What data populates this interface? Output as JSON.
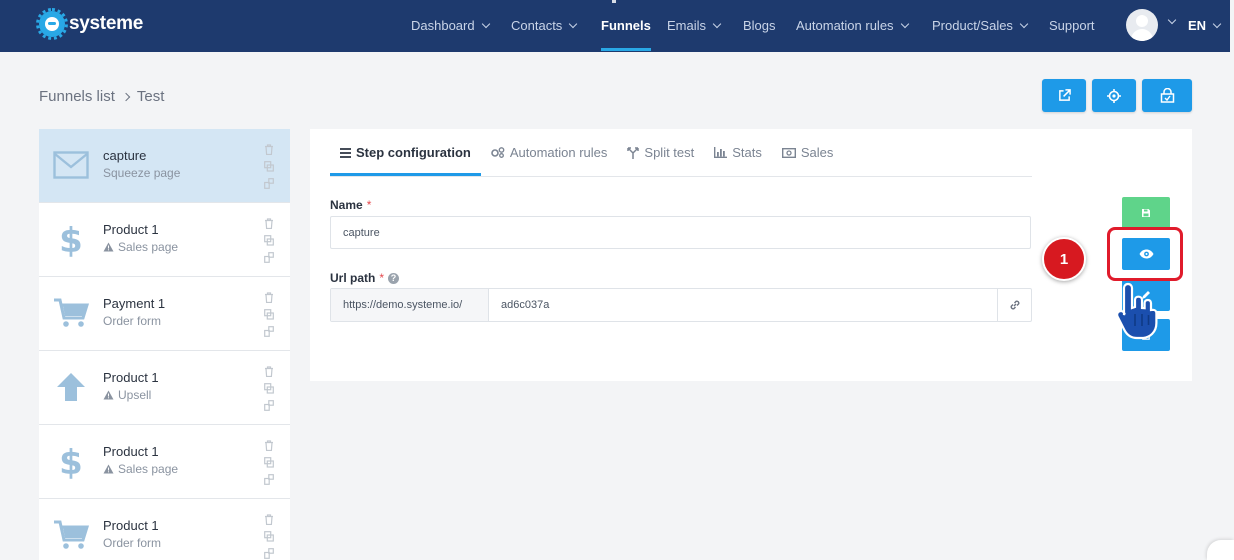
{
  "app": {
    "logo_text": "systeme"
  },
  "nav": {
    "items": [
      {
        "label": "Dashboard",
        "dropdown": true
      },
      {
        "label": "Contacts",
        "dropdown": true
      },
      {
        "label": "Funnels",
        "dropdown": false,
        "active": true
      },
      {
        "label": "Emails",
        "dropdown": true
      },
      {
        "label": "Blogs",
        "dropdown": false
      },
      {
        "label": "Automation rules",
        "dropdown": true
      },
      {
        "label": "Product/Sales",
        "dropdown": true
      },
      {
        "label": "Support",
        "dropdown": false
      }
    ],
    "language": "EN"
  },
  "breadcrumb": {
    "parent": "Funnels list",
    "current": "Test"
  },
  "top_actions": {
    "icons": [
      "external-link-icon",
      "gear-icon",
      "share-icon"
    ]
  },
  "steps": [
    {
      "title": "capture",
      "subtitle": "Squeeze page",
      "icon": "envelope-icon",
      "warning": false,
      "selected": true
    },
    {
      "title": "Product 1",
      "subtitle": "Sales page",
      "icon": "dollar-icon",
      "warning": true,
      "selected": false
    },
    {
      "title": "Payment 1",
      "subtitle": "Order form",
      "icon": "cart-icon",
      "warning": false,
      "selected": false
    },
    {
      "title": "Product 1",
      "subtitle": "Upsell",
      "icon": "arrow-up-icon",
      "warning": true,
      "selected": false
    },
    {
      "title": "Product 1",
      "subtitle": "Sales page",
      "icon": "dollar-icon",
      "warning": true,
      "selected": false
    },
    {
      "title": "Product 1",
      "subtitle": "Order form",
      "icon": "cart-icon",
      "warning": false,
      "selected": false
    }
  ],
  "tabs": [
    {
      "label": "Step configuration",
      "active": true
    },
    {
      "label": "Automation rules",
      "active": false
    },
    {
      "label": "Split test",
      "active": false
    },
    {
      "label": "Stats",
      "active": false
    },
    {
      "label": "Sales",
      "active": false
    }
  ],
  "form": {
    "name_label": "Name",
    "name_value": "capture",
    "url_label": "Url path",
    "url_prefix": "https://demo.systeme.io/",
    "url_value": "ad6c037a",
    "required_mark": "*"
  },
  "annotation": {
    "number": "1"
  },
  "colors": {
    "navbar": "#1e3a6e",
    "primary": "#1e9ae8",
    "save": "#5fd48a",
    "highlight": "#e01b2b",
    "selected_step": "#d4e6f4"
  }
}
